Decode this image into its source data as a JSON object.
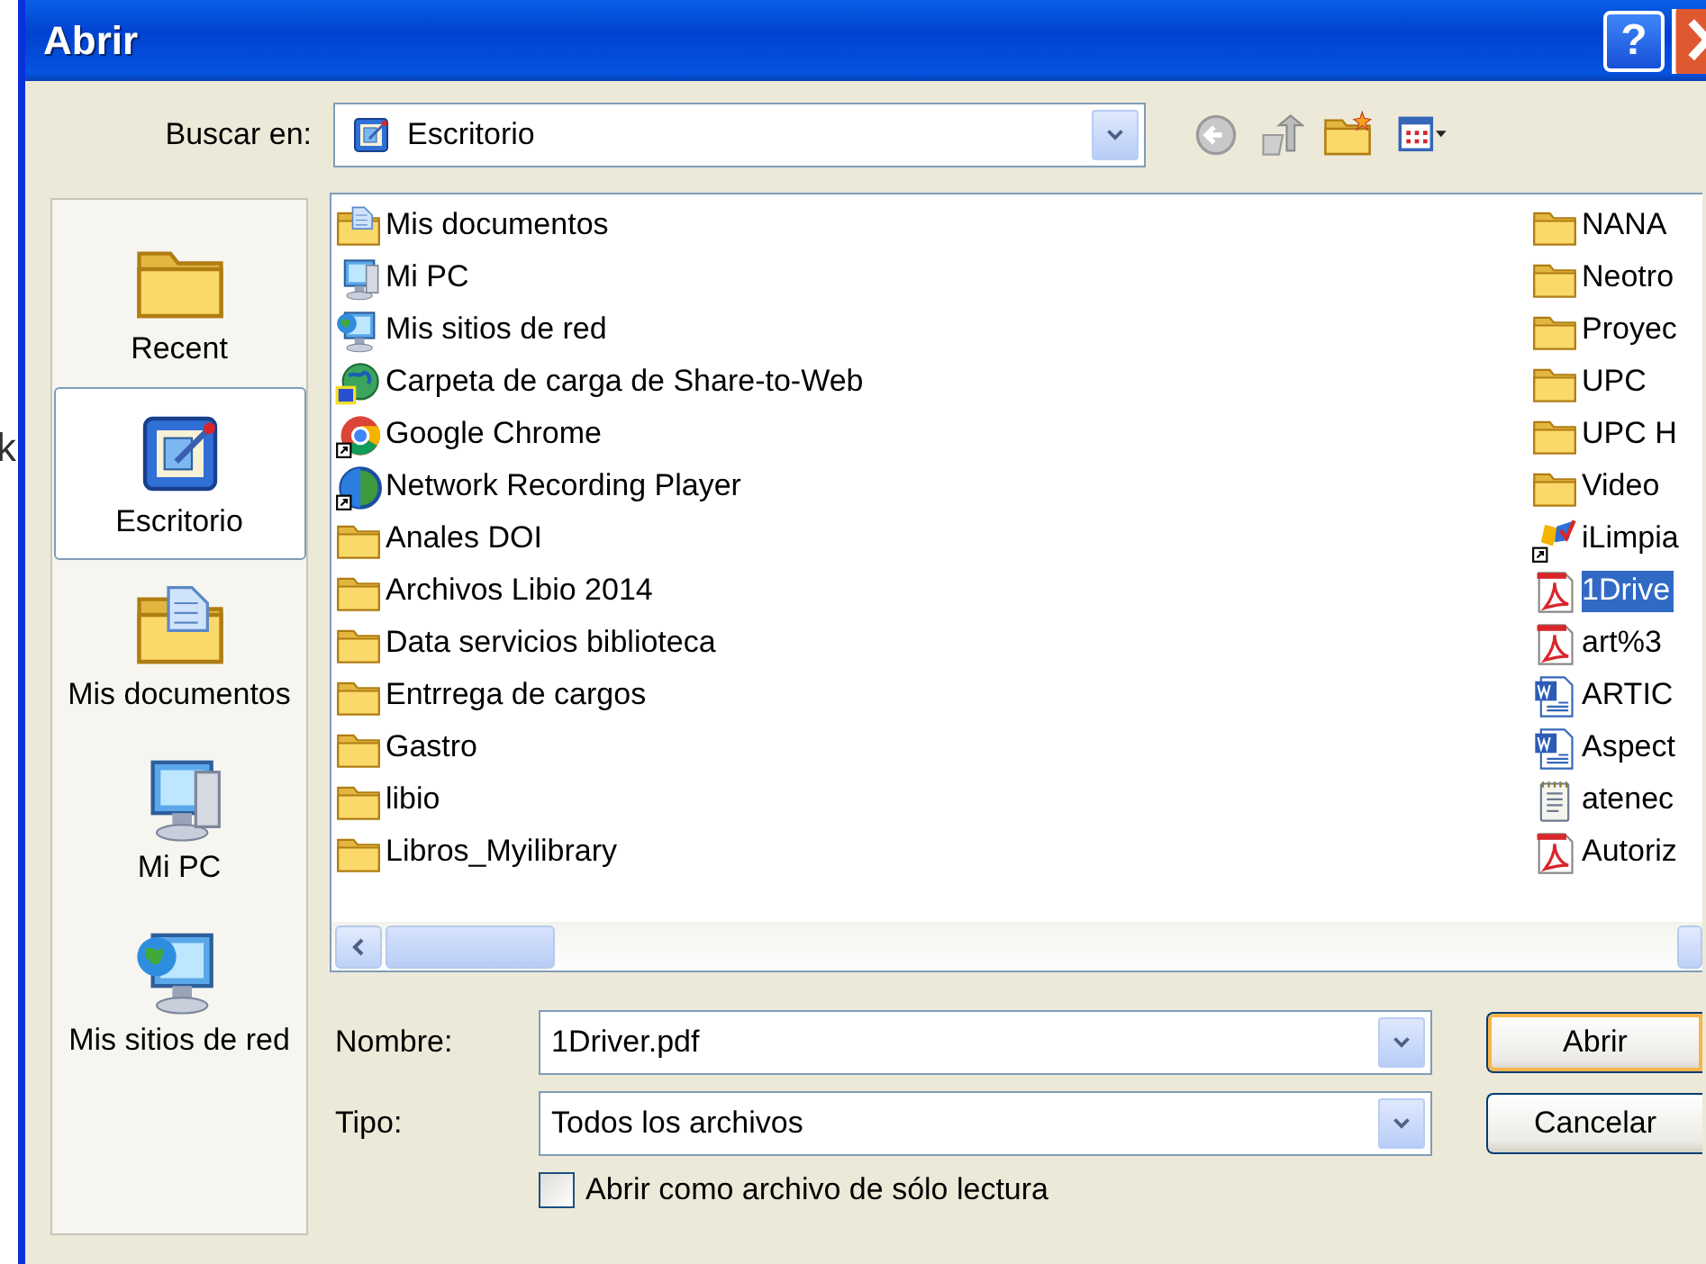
{
  "background": {
    "fragment": "k"
  },
  "window": {
    "title": "Abrir",
    "help_button": "?"
  },
  "look_in": {
    "label": "Buscar en:",
    "value": "Escritorio"
  },
  "places": [
    {
      "label": "Recent",
      "kind": "recent",
      "selected": false
    },
    {
      "label": "Escritorio",
      "kind": "desktop",
      "selected": true
    },
    {
      "label": "Mis documentos",
      "kind": "mydocs",
      "selected": false
    },
    {
      "label": "Mi PC",
      "kind": "pc",
      "selected": false
    },
    {
      "label": "Mis sitios de red",
      "kind": "network",
      "selected": false
    }
  ],
  "files": {
    "columns": [
      [
        {
          "name": "Mis documentos",
          "kind": "mydocs",
          "selected": false
        },
        {
          "name": "Mi PC",
          "kind": "pc",
          "selected": false
        },
        {
          "name": "Mis sitios de red",
          "kind": "network",
          "selected": false
        },
        {
          "name": "Carpeta de carga de Share-to-Web",
          "kind": "share",
          "selected": false
        },
        {
          "name": "Google Chrome",
          "kind": "chrome",
          "selected": false
        },
        {
          "name": "Network Recording Player",
          "kind": "player",
          "selected": false
        },
        {
          "name": "Anales DOI",
          "kind": "folder",
          "selected": false
        },
        {
          "name": "Archivos Libio 2014",
          "kind": "folder",
          "selected": false
        },
        {
          "name": "Data servicios biblioteca",
          "kind": "folder",
          "selected": false
        },
        {
          "name": "Entrrega de cargos",
          "kind": "folder",
          "selected": false
        },
        {
          "name": "Gastro",
          "kind": "folder",
          "selected": false
        },
        {
          "name": "libio",
          "kind": "folder",
          "selected": false
        },
        {
          "name": "Libros_Myilibrary",
          "kind": "folder",
          "selected": false
        }
      ],
      [
        {
          "name": "NANA",
          "kind": "folder",
          "selected": false
        },
        {
          "name": "Neotro",
          "kind": "folder",
          "selected": false
        },
        {
          "name": "Proyec",
          "kind": "folder",
          "selected": false
        },
        {
          "name": "UPC",
          "kind": "folder",
          "selected": false
        },
        {
          "name": "UPC H",
          "kind": "folder",
          "selected": false
        },
        {
          "name": "Video",
          "kind": "folder",
          "selected": false
        },
        {
          "name": "iLimpia",
          "kind": "shortcut",
          "selected": false
        },
        {
          "name": "1Drive",
          "kind": "pdf",
          "selected": true
        },
        {
          "name": "art%3",
          "kind": "pdf",
          "selected": false
        },
        {
          "name": "ARTIC",
          "kind": "word",
          "selected": false
        },
        {
          "name": "Aspect",
          "kind": "word",
          "selected": false
        },
        {
          "name": "atenec",
          "kind": "text",
          "selected": false
        },
        {
          "name": "Autoriz",
          "kind": "pdf",
          "selected": false
        }
      ]
    ]
  },
  "name_field": {
    "label": "Nombre:",
    "value": "1Driver.pdf"
  },
  "type_field": {
    "label": "Tipo:",
    "value": "Todos los archivos"
  },
  "read_only": {
    "label": "Abrir como archivo de sólo lectura",
    "checked": false
  },
  "buttons": [
    {
      "label": "Abrir",
      "default": true
    },
    {
      "label": "Cancelar",
      "default": false
    }
  ]
}
